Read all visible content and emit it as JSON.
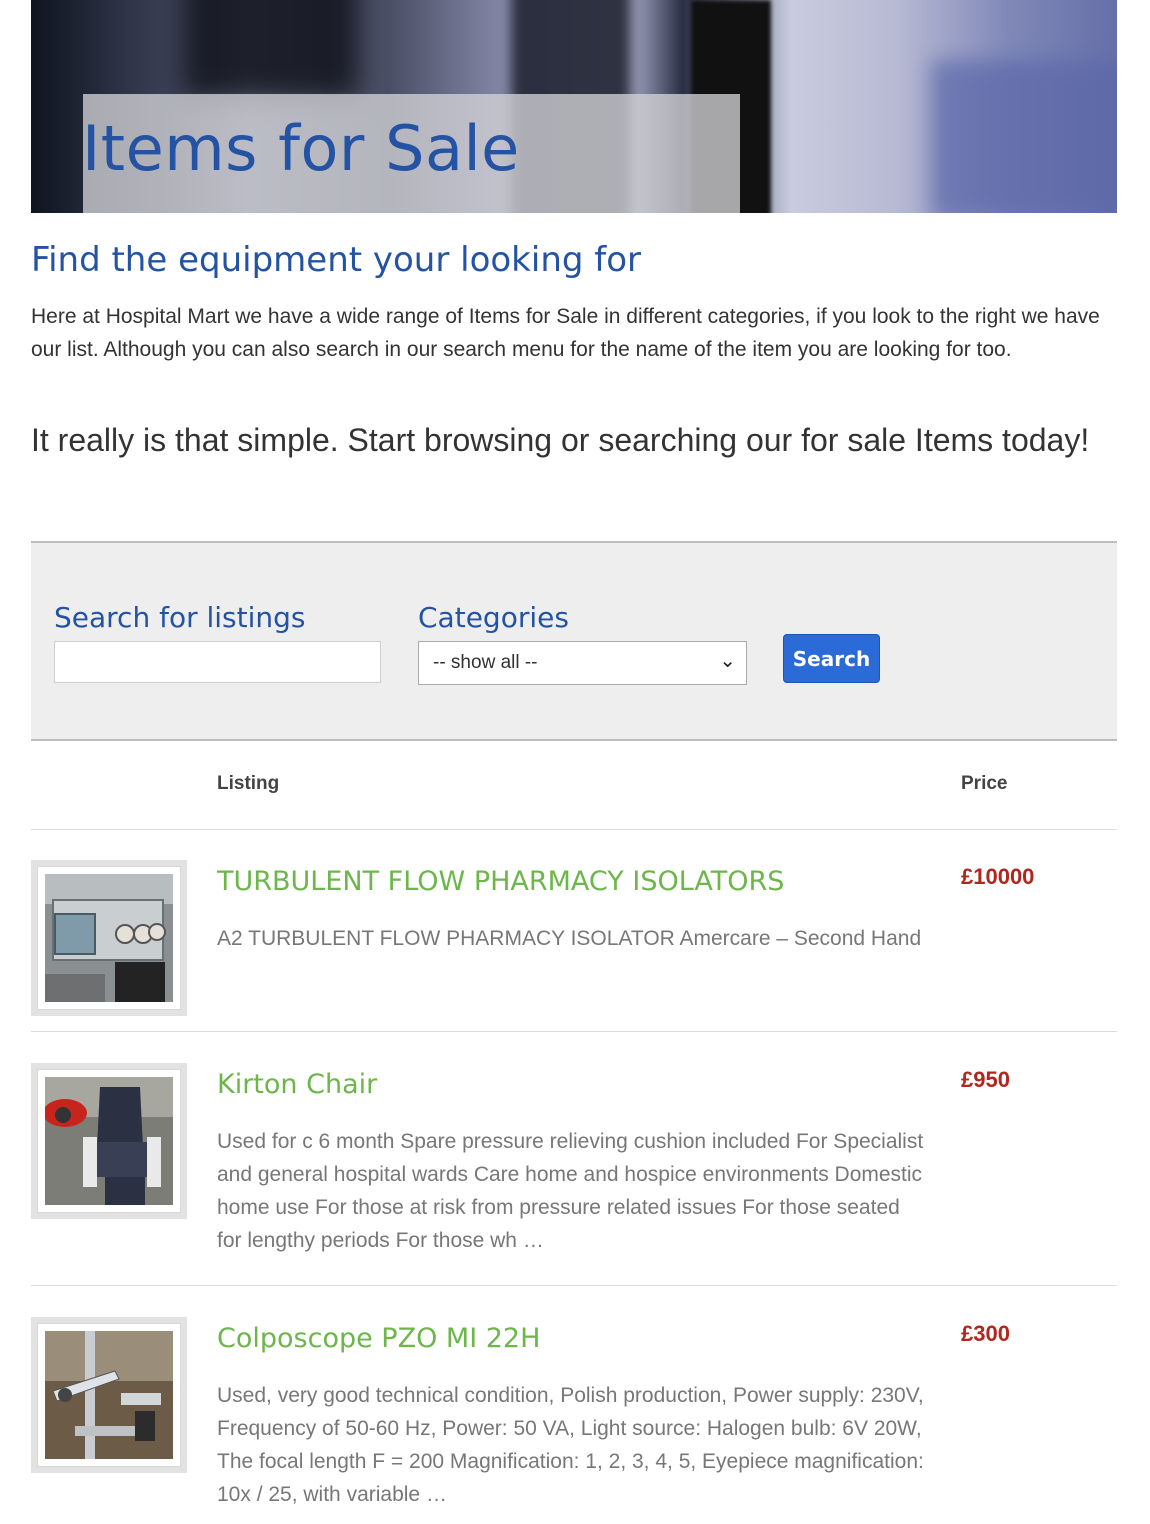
{
  "hero": {
    "title": "Items for Sale"
  },
  "intro": {
    "heading": "Find the equipment your looking for",
    "text": "Here at Hospital Mart we have a wide range of Items for Sale in different categories, if you look to the right we have our list. Although you can also search in our search menu for the name of the item you are looking for too.",
    "tagline": "It really is that simple. Start browsing or searching our for sale Items today!"
  },
  "search": {
    "label": "Search for listings",
    "value": "",
    "categories_label": "Categories",
    "category_selected": "-- show all --",
    "button": "Search"
  },
  "table": {
    "col_listing": "Listing",
    "col_price": "Price"
  },
  "listings": [
    {
      "title": "TURBULENT FLOW PHARMACY ISOLATORS",
      "description": "A2 TURBULENT FLOW PHARMACY ISOLATOR Amercare – Second Hand",
      "price": "£10000"
    },
    {
      "title": "Kirton Chair",
      "description": "Used for c 6 month Spare pressure relieving cushion included For Specialist and general hospital wards Care home and hospice environments Domestic home use For those at risk from pressure related issues For those seated for lengthy periods For those wh …",
      "price": "£950"
    },
    {
      "title": "Colposcope PZO MI 22H",
      "description": "Used, very good technical condition, Polish production, Power supply: 230V, Frequency of 50-60 Hz, Power: 50 VA, Light source: Halogen bulb: 6V 20W, The focal length F = 200 Magnification: 1, 2, 3, 4, 5, Eyepiece magnification: 10x / 25, with variable …",
      "price": "£300"
    }
  ]
}
